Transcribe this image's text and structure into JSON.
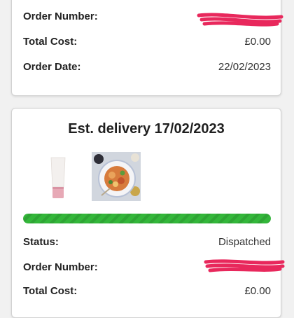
{
  "order_1": {
    "order_number_label": "Order Number:",
    "total_cost_label": "Total Cost:",
    "total_cost": "£0.00",
    "order_date_label": "Order Date:",
    "order_date": "22/02/2023"
  },
  "order_2": {
    "heading": "Est. delivery 17/02/2023",
    "products": [
      {
        "name": "tube-product-image"
      },
      {
        "name": "food-plate-product-image"
      }
    ],
    "progress_fraction": 1.0,
    "status_label": "Status:",
    "status": "Dispatched",
    "order_number_label": "Order Number:",
    "total_cost_label": "Total Cost:",
    "total_cost": "£0.00"
  },
  "colors": {
    "progress": "#33b73a",
    "redaction": "#e8285c"
  }
}
